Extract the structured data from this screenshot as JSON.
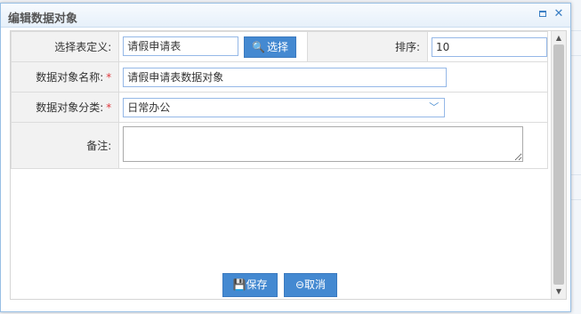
{
  "dialog": {
    "title": "编辑数据对象",
    "maximize_icon": "maximize-icon",
    "close_icon": "close-icon"
  },
  "form": {
    "table_def_label": "选择表定义:",
    "table_def_value": "请假申请表",
    "select_button": "选择",
    "sort_label": "排序:",
    "sort_value": "10",
    "name_label": "数据对象名称:",
    "name_value": "请假申请表数据对象",
    "required_mark": "*",
    "category_label": "数据对象分类:",
    "category_value": "日常办公",
    "remark_label": "备注:",
    "remark_value": ""
  },
  "buttons": {
    "save": "保存",
    "cancel": "取消"
  },
  "colors": {
    "accent": "#4489d1",
    "required": "#e0393e",
    "border": "#95b8e7"
  }
}
